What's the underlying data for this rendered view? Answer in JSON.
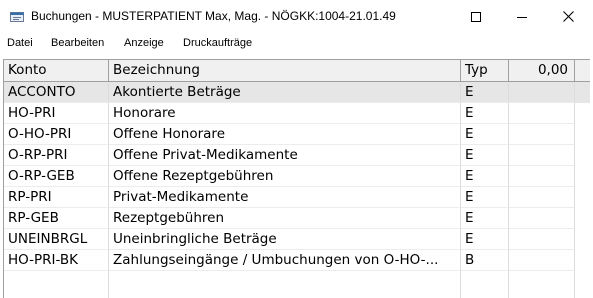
{
  "window": {
    "title": "Buchungen  - MUSTERPATIENT Max, Mag. - NÖGKK:1004-21.01.49",
    "icon": "app-icon",
    "controls": {
      "minimize": "minimize-icon",
      "maximize": "maximize-icon",
      "close": "close-icon"
    }
  },
  "menu": {
    "items": [
      "Datei",
      "Bearbeiten",
      "Anzeige",
      "Druckaufträge"
    ]
  },
  "grid": {
    "columns": [
      "Konto",
      "Bezeichnung",
      "Typ",
      "0,00"
    ],
    "rows": [
      {
        "konto": "ACCONTO",
        "bezeichnung": "Akontierte Beträge",
        "typ": "E",
        "selected": true
      },
      {
        "konto": "HO-PRI",
        "bezeichnung": "Honorare",
        "typ": "E"
      },
      {
        "konto": "O-HO-PRI",
        "bezeichnung": "Offene Honorare",
        "typ": "E"
      },
      {
        "konto": "O-RP-PRI",
        "bezeichnung": "Offene Privat-Medikamente",
        "typ": "E"
      },
      {
        "konto": "O-RP-GEB",
        "bezeichnung": "Offene Rezeptgebühren",
        "typ": "E"
      },
      {
        "konto": "RP-PRI",
        "bezeichnung": "Privat-Medikamente",
        "typ": "E"
      },
      {
        "konto": "RP-GEB",
        "bezeichnung": "Rezeptgebühren",
        "typ": "E"
      },
      {
        "konto": "UNEINBRGL",
        "bezeichnung": "Uneinbringliche Beträge",
        "typ": "E"
      },
      {
        "konto": "HO-PRI-BK",
        "bezeichnung": "Zahlungseingänge / Umbuchungen von O-HO-...",
        "typ": "B"
      }
    ]
  }
}
